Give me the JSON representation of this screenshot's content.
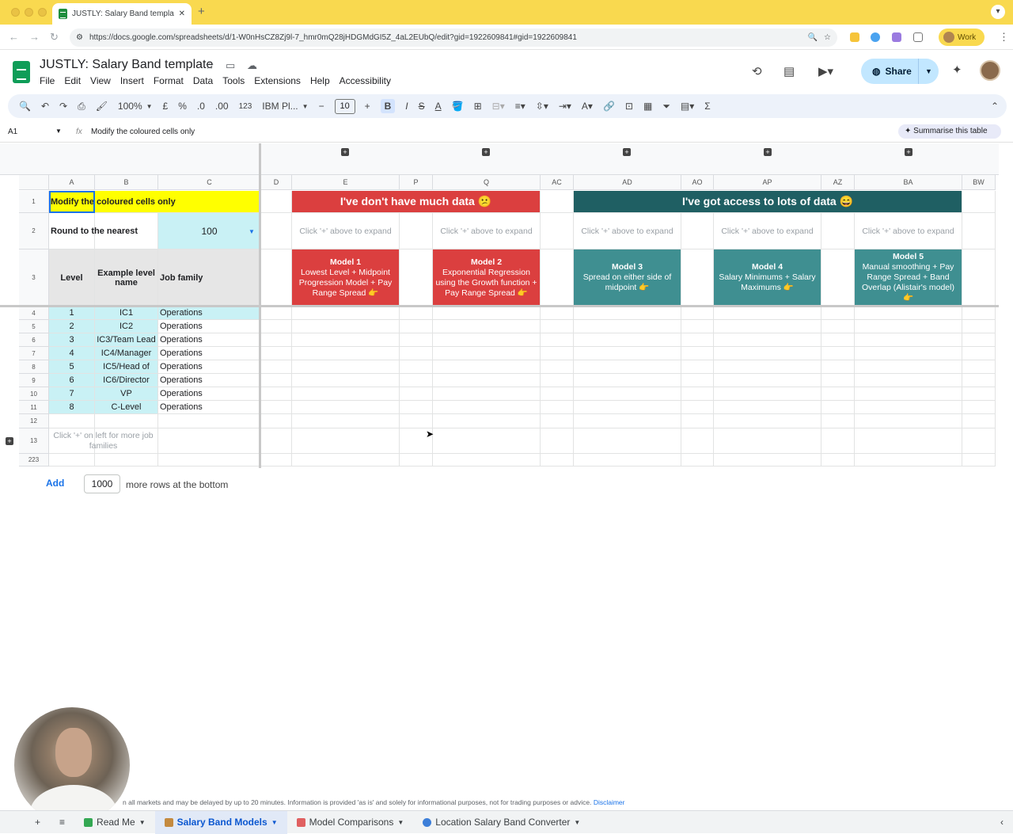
{
  "browser": {
    "tab_title": "JUSTLY: Salary Band templat",
    "url": "https://docs.google.com/spreadsheets/d/1-W0nHsCZ8Zj9l-7_hmr0mQ28jHDGMdGI5Z_4aL2EUbQ/edit?gid=1922609841#gid=1922609841",
    "profile_label": "Work"
  },
  "doc": {
    "title": "JUSTLY: Salary Band template",
    "menus": [
      "File",
      "Edit",
      "View",
      "Insert",
      "Format",
      "Data",
      "Tools",
      "Extensions",
      "Help",
      "Accessibility"
    ],
    "share_label": "Share"
  },
  "toolbar": {
    "zoom": "100%",
    "currency": "£",
    "percent": "%",
    "dec_less": ".0",
    "dec_more": ".00",
    "number_fmt": "123",
    "font": "IBM Pl...",
    "font_size": "10",
    "bold": "B",
    "italic": "I",
    "strike": "S",
    "text_color": "A"
  },
  "formula_bar": {
    "name_box": "A1",
    "fx": "fx",
    "content": "Modify the coloured cells only",
    "summarise": "✦ Summarise this table"
  },
  "columns": [
    "A",
    "B",
    "C",
    "D",
    "E",
    "P",
    "Q",
    "AC",
    "AD",
    "AO",
    "AP",
    "AZ",
    "BA",
    "BW"
  ],
  "row_numbers": [
    "1",
    "2",
    "3",
    "4",
    "5",
    "6",
    "7",
    "8",
    "9",
    "10",
    "11",
    "12",
    "13",
    "223"
  ],
  "sheet": {
    "a1": "Modify the coloured cells only",
    "round_label": "Round to the nearest",
    "round_value": "100",
    "headers": {
      "level": "Level",
      "example": "Example level name",
      "family": "Job family"
    },
    "levels": [
      {
        "level": "1",
        "name": "IC1",
        "family": "Operations"
      },
      {
        "level": "2",
        "name": "IC2",
        "family": "Operations"
      },
      {
        "level": "3",
        "name": "IC3/Team Lead",
        "family": "Operations"
      },
      {
        "level": "4",
        "name": "IC4/Manager",
        "family": "Operations"
      },
      {
        "level": "5",
        "name": "IC5/Head of",
        "family": "Operations"
      },
      {
        "level": "6",
        "name": "IC6/Director",
        "family": "Operations"
      },
      {
        "level": "7",
        "name": "VP",
        "family": "Operations"
      },
      {
        "level": "8",
        "name": "C-Level",
        "family": "Operations"
      }
    ],
    "more_families": "Click '+' on left for more job families",
    "group_little": "I've don't have much data 😕",
    "group_lots": "I've got access to lots of data 😄",
    "expand_hint": "Click '+' above to expand",
    "models": [
      {
        "title": "Model 1",
        "desc": "Lowest Level + Midpoint Progression Model + Pay Range Spread 👉",
        "color": "#db3f3f"
      },
      {
        "title": "Model 2",
        "desc": "Exponential Regression using the Growth function + Pay Range Spread 👉",
        "color": "#db3f3f"
      },
      {
        "title": "Model 3",
        "desc": "Spread on either side of midpoint 👉",
        "color": "#3f8f91"
      },
      {
        "title": "Model 4",
        "desc": "Salary Minimums + Salary Maximums 👉",
        "color": "#3f8f91"
      },
      {
        "title": "Model 5",
        "desc": "Manual smoothing + Pay Range Spread + Band Overlap (Alistair's model) 👉",
        "color": "#3f8f91"
      }
    ]
  },
  "add_rows": {
    "label": "Add",
    "count": "1000",
    "suffix": "more rows at the bottom"
  },
  "disclaimer": {
    "text": "n all markets and may be delayed by up to 20 minutes. Information is provided 'as is' and solely for informational purposes, not for trading purposes or advice.",
    "link": "Disclaimer"
  },
  "sheet_tabs": [
    "Read Me",
    "Salary Band Models",
    "Model Comparisons",
    "Location Salary Band Converter"
  ],
  "colors": {
    "yellow": "#ffff00",
    "cyan": "#c9f1f5",
    "red": "#db3f3f",
    "teal_dark": "#1f5f63",
    "teal": "#3f8f91"
  }
}
